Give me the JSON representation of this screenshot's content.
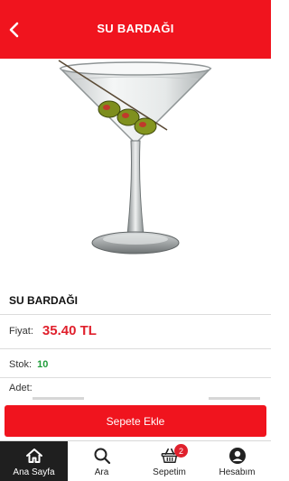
{
  "header": {
    "title": "SU BARDAĞI",
    "back_icon": "chevron-left-icon",
    "background_color": "#f0141e"
  },
  "product": {
    "image_subject": "martini glass with three olives on a skewer",
    "name": "SU BARDAĞI",
    "price_label": "Fiyat:",
    "price_value": "35.40 TL",
    "price_color": "#e0212d",
    "stock_label": "Stok:",
    "stock_value": "10",
    "stock_color": "#1f9d3a",
    "quantity_label": "Adet:"
  },
  "actions": {
    "add_to_cart_label": "Sepete Ekle"
  },
  "tabbar": {
    "items": [
      {
        "label": "Ana Sayfa",
        "icon": "home-icon",
        "active": true
      },
      {
        "label": "Ara",
        "icon": "search-icon",
        "active": false
      },
      {
        "label": "Sepetim",
        "icon": "basket-icon",
        "active": false,
        "badge": "2"
      },
      {
        "label": "Hesabım",
        "icon": "account-icon",
        "active": false
      }
    ]
  }
}
